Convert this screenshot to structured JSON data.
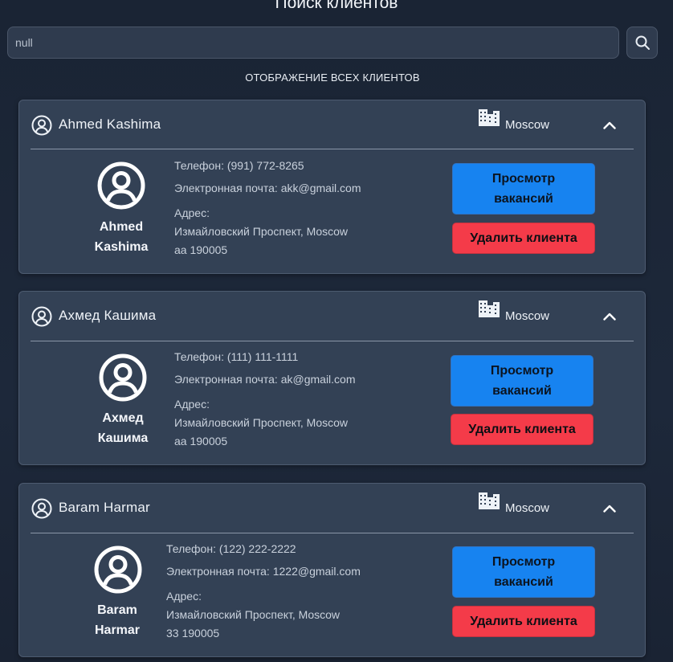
{
  "page": {
    "title": "Поиск клиентов",
    "subtitle": "ОТОБРАЖЕНИЕ ВСЕХ КЛИЕНТОВ"
  },
  "search": {
    "value": "null",
    "icon": "search-icon"
  },
  "clients": [
    {
      "name": "Ahmed Kashima",
      "name_line1": "Ahmed",
      "name_line2": "Kashima",
      "city": "Moscow",
      "phone": "Телефон: (991) 772-8265",
      "email": "Электронная почта: akk@gmail.com",
      "address_label": "Адрес:",
      "address_line": "Измайловский Проспект, Moscow",
      "address_zip": "aa 190005",
      "view_label": "Просмотр вакансий",
      "delete_label": "Удалить клиента"
    },
    {
      "name": "Ахмед Кашима",
      "name_line1": "Ахмед",
      "name_line2": "Кашима",
      "city": "Moscow",
      "phone": "Телефон: (111) 111-1111",
      "email": "Электронная почта: ak@gmail.com",
      "address_label": "Адрес:",
      "address_line": "Измайловский Проспект, Moscow",
      "address_zip": "aa 190005",
      "view_label": "Просмотр вакансий",
      "delete_label": "Удалить клиента"
    },
    {
      "name": "Baram Harmar",
      "name_line1": "Baram",
      "name_line2": "Harmar",
      "city": "Moscow",
      "phone": "Телефон: (122) 222-2222",
      "email": "Электронная почта: 1222@gmail.com",
      "address_label": "Адрес:",
      "address_line": "Измайловский Проспект, Moscow",
      "address_zip": "33 190005",
      "view_label": "Просмотр вакансий",
      "delete_label": "Удалить клиента"
    }
  ],
  "colors": {
    "background": "#1b2536",
    "card": "#334155",
    "view_button": "#1783f0",
    "delete_button": "#f43b49"
  }
}
